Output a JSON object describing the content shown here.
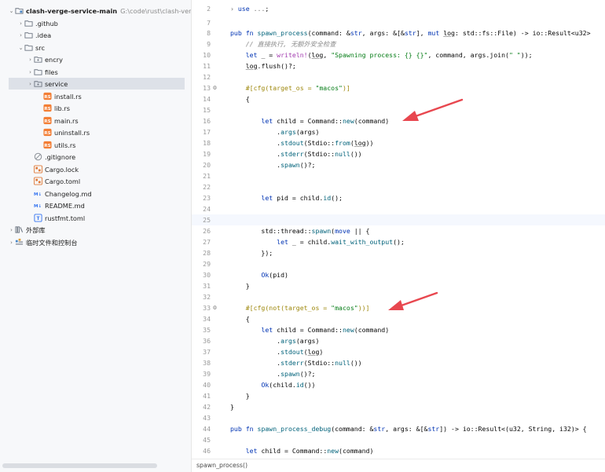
{
  "project_tree": {
    "rows": [
      {
        "label": "clash-verge-service-main",
        "hint": "G:\\code\\rust\\clash-verge-se",
        "indent": 0,
        "arrow": "⌄",
        "icon": "module-folder-icon",
        "bold": true
      },
      {
        "label": ".github",
        "indent": 1,
        "arrow": "›",
        "icon": "folder-icon"
      },
      {
        "label": ".idea",
        "indent": 1,
        "arrow": "›",
        "icon": "folder-icon"
      },
      {
        "label": "src",
        "indent": 1,
        "arrow": "⌄",
        "icon": "folder-icon"
      },
      {
        "label": "encry",
        "indent": 2,
        "arrow": "›",
        "icon": "package-folder-icon"
      },
      {
        "label": "files",
        "indent": 2,
        "arrow": "›",
        "icon": "folder-icon"
      },
      {
        "label": "service",
        "indent": 2,
        "arrow": "›",
        "icon": "package-folder-icon",
        "selected": true
      },
      {
        "label": "install.rs",
        "indent": 3,
        "arrow": "",
        "icon": "rust-file-icon"
      },
      {
        "label": "lib.rs",
        "indent": 3,
        "arrow": "",
        "icon": "rust-file-icon"
      },
      {
        "label": "main.rs",
        "indent": 3,
        "arrow": "",
        "icon": "rust-file-icon"
      },
      {
        "label": "uninstall.rs",
        "indent": 3,
        "arrow": "",
        "icon": "rust-file-icon"
      },
      {
        "label": "utils.rs",
        "indent": 3,
        "arrow": "",
        "icon": "rust-file-icon"
      },
      {
        "label": ".gitignore",
        "indent": 2,
        "arrow": "",
        "icon": "gitignore-icon"
      },
      {
        "label": "Cargo.lock",
        "indent": 2,
        "arrow": "",
        "icon": "cargo-file-icon"
      },
      {
        "label": "Cargo.toml",
        "indent": 2,
        "arrow": "",
        "icon": "cargo-file-icon"
      },
      {
        "label": "Changelog.md",
        "indent": 2,
        "arrow": "",
        "icon": "markdown-file-icon",
        "badge": "M↓"
      },
      {
        "label": "README.md",
        "indent": 2,
        "arrow": "",
        "icon": "markdown-file-icon",
        "badge": "M↓"
      },
      {
        "label": "rustfmt.toml",
        "indent": 2,
        "arrow": "",
        "icon": "toml-file-icon"
      },
      {
        "label": "外部库",
        "indent": 0,
        "arrow": "›",
        "icon": "library-icon"
      },
      {
        "label": "临时文件和控制台",
        "indent": 0,
        "arrow": "›",
        "icon": "scratches-icon"
      }
    ]
  },
  "editor": {
    "lines": [
      {
        "n": "2",
        "segs": [
          [
            "fold",
            "› "
          ],
          [
            "kw",
            "use"
          ],
          [
            "",
            " "
          ],
          [
            "fold",
            "..."
          ],
          [
            "",
            ";"
          ]
        ]
      },
      {
        "n": "7",
        "segs": []
      },
      {
        "n": "8",
        "segs": [
          [
            "kw",
            "pub fn "
          ],
          [
            "fn",
            "spawn_process"
          ],
          [
            "",
            "(command: &"
          ],
          [
            "kw",
            "str"
          ],
          [
            "",
            ", args: &["
          ],
          [
            "",
            "&"
          ],
          [
            "kw",
            "str"
          ],
          [
            "",
            "], "
          ],
          [
            "kw",
            "mut "
          ],
          [
            "ul",
            "log"
          ],
          [
            "",
            ": std::fs::File) -> io::Result<u32>"
          ]
        ]
      },
      {
        "n": "9",
        "segs": [
          [
            "",
            "    "
          ],
          [
            "cm",
            "// 直接执行, 无额外安全检查"
          ]
        ]
      },
      {
        "n": "10",
        "segs": [
          [
            "",
            "    "
          ],
          [
            "kw",
            "let"
          ],
          [
            "",
            " _ = "
          ],
          [
            "mac",
            "writeln!"
          ],
          [
            "",
            "("
          ],
          [
            "ul",
            "log"
          ],
          [
            "",
            ", "
          ],
          [
            "str",
            "\"Spawning process: {} {}\""
          ],
          [
            "",
            ", command, args.join("
          ],
          [
            "str",
            "\" \""
          ],
          [
            "",
            "));"
          ]
        ]
      },
      {
        "n": "11",
        "segs": [
          [
            "",
            "    "
          ],
          [
            "ul",
            "log"
          ],
          [
            "",
            ".flush()?;"
          ]
        ]
      },
      {
        "n": "12",
        "segs": []
      },
      {
        "n": "13",
        "gutter": "⚙",
        "segs": [
          [
            "",
            "    "
          ],
          [
            "attr",
            "#[cfg(target_os = "
          ],
          [
            "str",
            "\"macos\""
          ],
          [
            "attr",
            ")]"
          ]
        ]
      },
      {
        "n": "14",
        "segs": [
          [
            "",
            "    {"
          ]
        ]
      },
      {
        "n": "15",
        "segs": []
      },
      {
        "n": "16",
        "segs": [
          [
            "",
            "        "
          ],
          [
            "kw",
            "let"
          ],
          [
            "",
            " child = Command::"
          ],
          [
            "fn",
            "new"
          ],
          [
            "",
            "(command)"
          ]
        ]
      },
      {
        "n": "17",
        "segs": [
          [
            "",
            "            ."
          ],
          [
            "fn",
            "args"
          ],
          [
            "",
            "(args)"
          ]
        ]
      },
      {
        "n": "18",
        "segs": [
          [
            "",
            "            ."
          ],
          [
            "fn",
            "stdout"
          ],
          [
            "",
            "(Stdio::"
          ],
          [
            "fn",
            "from"
          ],
          [
            "",
            "("
          ],
          [
            "ul",
            "log"
          ],
          [
            "",
            "))"
          ]
        ]
      },
      {
        "n": "19",
        "segs": [
          [
            "",
            "            ."
          ],
          [
            "fn",
            "stderr"
          ],
          [
            "",
            "(Stdio::"
          ],
          [
            "fn",
            "null"
          ],
          [
            "",
            "())"
          ]
        ]
      },
      {
        "n": "20",
        "segs": [
          [
            "",
            "            ."
          ],
          [
            "fn",
            "spawn"
          ],
          [
            "",
            "()?;"
          ]
        ]
      },
      {
        "n": "21",
        "segs": []
      },
      {
        "n": "22",
        "segs": []
      },
      {
        "n": "23",
        "segs": [
          [
            "",
            "        "
          ],
          [
            "kw",
            "let"
          ],
          [
            "",
            " pid = child."
          ],
          [
            "fn",
            "id"
          ],
          [
            "",
            "();"
          ]
        ]
      },
      {
        "n": "24",
        "segs": []
      },
      {
        "n": "25",
        "current": true,
        "segs": []
      },
      {
        "n": "26",
        "segs": [
          [
            "",
            "        std::thread::"
          ],
          [
            "fn",
            "spawn"
          ],
          [
            "",
            "("
          ],
          [
            "kw",
            "move"
          ],
          [
            "",
            " || {"
          ]
        ]
      },
      {
        "n": "27",
        "segs": [
          [
            "",
            "            "
          ],
          [
            "kw",
            "let"
          ],
          [
            "",
            " _ = child."
          ],
          [
            "fn",
            "wait_with_output"
          ],
          [
            "",
            "();"
          ]
        ]
      },
      {
        "n": "28",
        "segs": [
          [
            "",
            "        });"
          ]
        ]
      },
      {
        "n": "29",
        "segs": []
      },
      {
        "n": "30",
        "segs": [
          [
            "",
            "        "
          ],
          [
            "kw",
            "Ok"
          ],
          [
            "",
            "(pid)"
          ]
        ]
      },
      {
        "n": "31",
        "segs": [
          [
            "",
            "    }"
          ]
        ]
      },
      {
        "n": "32",
        "segs": []
      },
      {
        "n": "33",
        "gutter": "⚙",
        "segs": [
          [
            "",
            "    "
          ],
          [
            "attr",
            "#[cfg(not(target_os = "
          ],
          [
            "str",
            "\"macos\""
          ],
          [
            "attr",
            "))]"
          ]
        ]
      },
      {
        "n": "34",
        "segs": [
          [
            "",
            "    {"
          ]
        ]
      },
      {
        "n": "35",
        "segs": [
          [
            "",
            "        "
          ],
          [
            "kw",
            "let"
          ],
          [
            "",
            " child = Command::"
          ],
          [
            "fn",
            "new"
          ],
          [
            "",
            "(command)"
          ]
        ]
      },
      {
        "n": "36",
        "segs": [
          [
            "",
            "            ."
          ],
          [
            "fn",
            "args"
          ],
          [
            "",
            "(args)"
          ]
        ]
      },
      {
        "n": "37",
        "segs": [
          [
            "",
            "            ."
          ],
          [
            "fn",
            "stdout"
          ],
          [
            "",
            "("
          ],
          [
            "ul",
            "log"
          ],
          [
            "",
            ")"
          ]
        ]
      },
      {
        "n": "38",
        "segs": [
          [
            "",
            "            ."
          ],
          [
            "fn",
            "stderr"
          ],
          [
            "",
            "(Stdio::"
          ],
          [
            "fn",
            "null"
          ],
          [
            "",
            "())"
          ]
        ]
      },
      {
        "n": "39",
        "segs": [
          [
            "",
            "            ."
          ],
          [
            "fn",
            "spawn"
          ],
          [
            "",
            "()?;"
          ]
        ]
      },
      {
        "n": "40",
        "segs": [
          [
            "",
            "        "
          ],
          [
            "kw",
            "Ok"
          ],
          [
            "",
            "(child."
          ],
          [
            "fn",
            "id"
          ],
          [
            "",
            "())"
          ]
        ]
      },
      {
        "n": "41",
        "segs": [
          [
            "",
            "    }"
          ]
        ]
      },
      {
        "n": "42",
        "segs": [
          [
            "",
            "}"
          ]
        ]
      },
      {
        "n": "43",
        "segs": []
      },
      {
        "n": "44",
        "segs": [
          [
            "kw",
            "pub fn "
          ],
          [
            "fn",
            "spawn_process_debug"
          ],
          [
            "",
            "(command: &"
          ],
          [
            "kw",
            "str"
          ],
          [
            "",
            ", args: &[&"
          ],
          [
            "kw",
            "str"
          ],
          [
            "",
            "]) -> io::Result<(u32, String, i32)> {"
          ]
        ]
      },
      {
        "n": "45",
        "segs": []
      },
      {
        "n": "46",
        "segs": [
          [
            "",
            "    "
          ],
          [
            "kw",
            "let"
          ],
          [
            "",
            " child = Command::"
          ],
          [
            "fn",
            "new"
          ],
          [
            "",
            "(command)"
          ]
        ]
      }
    ]
  },
  "status_bar": {
    "breadcrumb": "spawn_process()"
  },
  "colors": {
    "annotation_arrow": "#e8474f",
    "selection": "#dde1e8"
  }
}
